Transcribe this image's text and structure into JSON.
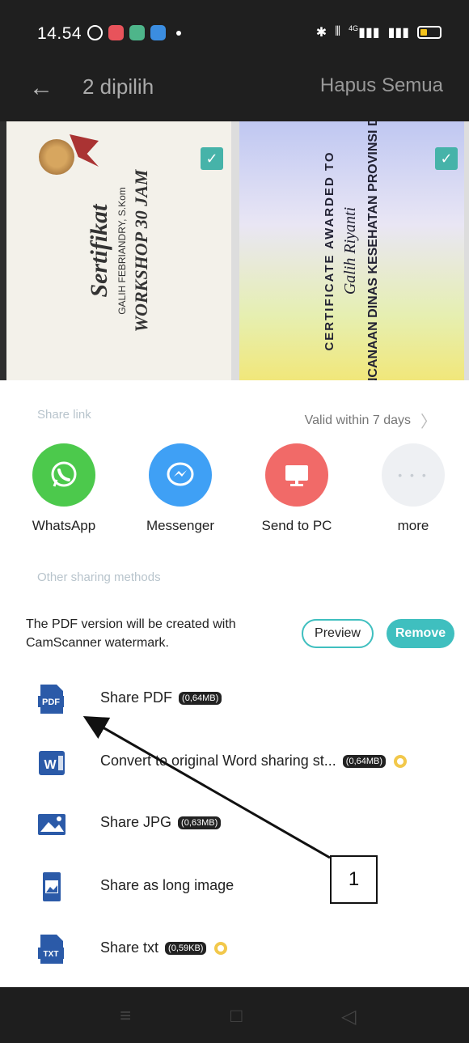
{
  "status": {
    "time": "14.54",
    "signal_text": "4G"
  },
  "appbar": {
    "back_icon": "back-arrow-icon",
    "title": "2 dipilih",
    "clear_all": "Hapus Semua"
  },
  "thumbnails": [
    {
      "title": "Sertifikat",
      "recipient": "GALIH FEBRIANDRY, S.Kom",
      "event": "WORKSHOP 30 JAM",
      "selected": true
    },
    {
      "title": "CERTIFICATE AWARDED TO",
      "recipient": "Galih Riyanti",
      "event": "SHOP PERENCANAAN DINAS KESEHATAN PROVINSI DKI JAKARTA",
      "selected": true
    }
  ],
  "share_link": {
    "section_label": "Share link",
    "validity": "Valid within 7 days",
    "items": [
      {
        "label": "WhatsApp",
        "icon": "whatsapp-icon",
        "color": "#4cc94c"
      },
      {
        "label": "Messenger",
        "icon": "messenger-icon",
        "color": "#3fa0f5"
      },
      {
        "label": "Send to PC",
        "icon": "monitor-icon",
        "color": "#f16a68"
      },
      {
        "label": "more",
        "icon": "more-icon",
        "color": "#eef0f3"
      }
    ]
  },
  "other_methods": {
    "section_label": "Other sharing methods",
    "watermark_note": "The PDF version will be created with CamScanner watermark.",
    "preview_label": "Preview",
    "remove_label": "Remove",
    "items": [
      {
        "label": "Share PDF",
        "size": "(0,64MB)",
        "icon": "pdf-file-icon",
        "premium": false
      },
      {
        "label": "Convert to original Word sharing st...",
        "size": "(0,64MB)",
        "icon": "word-file-icon",
        "premium": true
      },
      {
        "label": "Share JPG",
        "size": "(0,63MB)",
        "icon": "image-icon",
        "premium": false
      },
      {
        "label": "Share as long image",
        "size": "",
        "icon": "long-image-icon",
        "premium": false
      },
      {
        "label": "Share txt",
        "size": "(0,59KB)",
        "icon": "txt-file-icon",
        "premium": true
      }
    ]
  },
  "annotation": {
    "label": "1"
  },
  "colors": {
    "accent": "#3fbfbf",
    "dark_header": "#1f1f1f",
    "section_label": "#b8c4cc"
  }
}
